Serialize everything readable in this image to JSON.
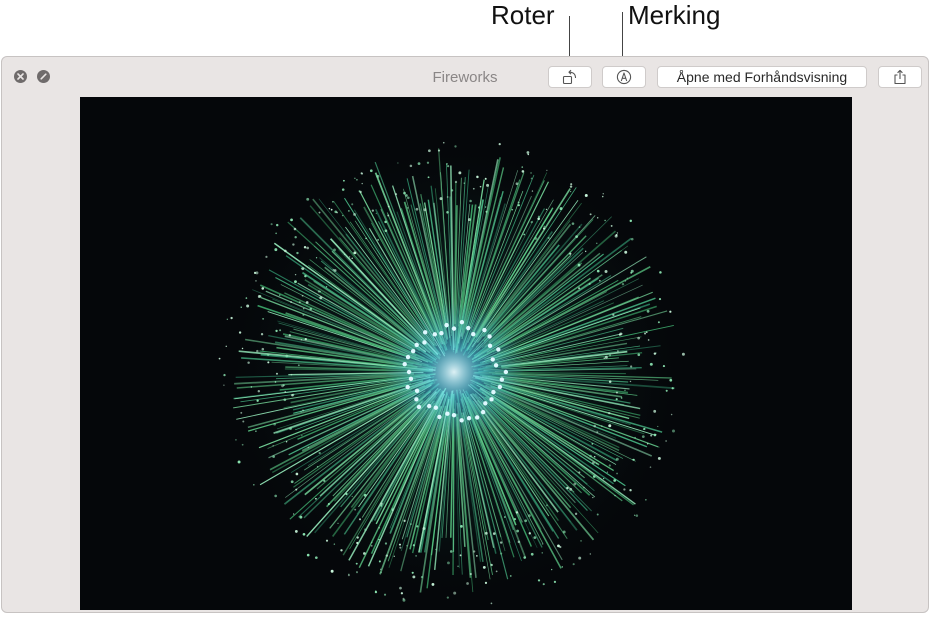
{
  "callouts": {
    "rotate_label": "Roter",
    "markup_label": "Merking"
  },
  "window": {
    "title": "Fireworks",
    "open_with_label": "Åpne med Forhåndsvisning"
  },
  "icons": {
    "close": "close-icon",
    "fullscreen": "fullscreen-icon",
    "rotate": "rotate-left-icon",
    "markup": "markup-pen-icon",
    "share": "share-icon"
  },
  "colors": {
    "window_bg": "#e9e5e4",
    "image_bg": "#05070a",
    "firework_green": "#5fd08a",
    "firework_cyan": "#7fe8ff"
  }
}
